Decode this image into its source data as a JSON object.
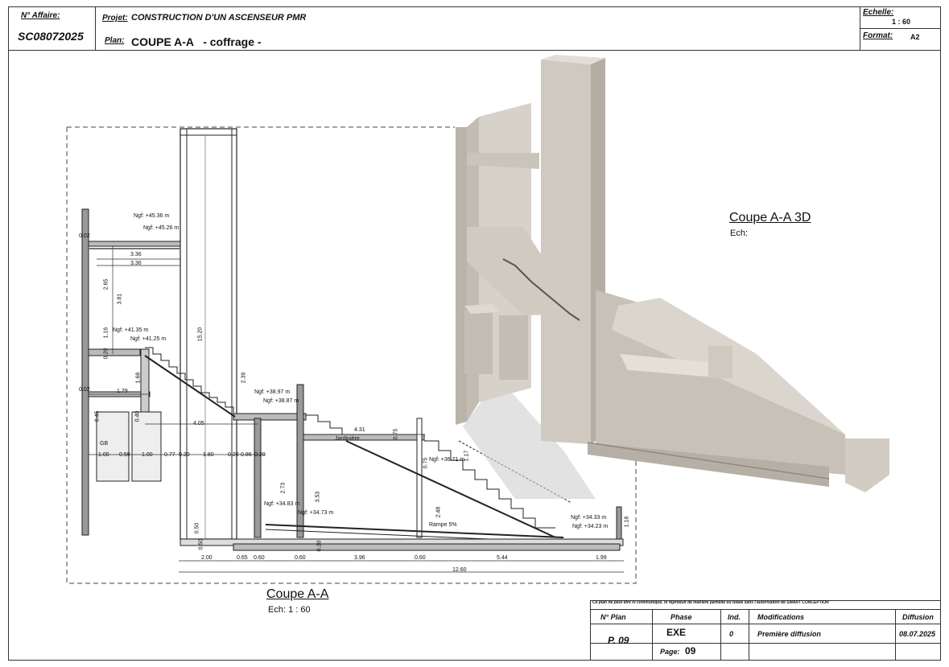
{
  "header": {
    "affaire_label": "N° Affaire:",
    "affaire_value": "SC08072025",
    "projet_label": "Projet:",
    "projet_value": "CONSTRUCTION D'UN ASCENSEUR PMR",
    "plan_label": "Plan:",
    "plan_value": "COUPE A-A   - coffrage -",
    "echelle_label": "Echelle:",
    "echelle_value": "1 : 60",
    "format_label": "Format:",
    "format_value": "A2"
  },
  "section_2d": {
    "title": "Coupe A-A",
    "scale": "Ech: 1 : 60",
    "levels": [
      "Ngf: +45.36 m",
      "Ngf: +45.26 m",
      "Ngf: +41.35 m",
      "Ngf: +41.25 m",
      "Ngf: +38.97 m",
      "Ngf: +38.87 m",
      "Ngf: +36.71 m",
      "Ngf: +34.83 m",
      "Ngf: +34.73 m",
      "Ngf: +34.33 m",
      "Ngf: +34.23 m"
    ],
    "labels": {
      "jardiniere": "Jardinière",
      "rampe": "Rampe 5%",
      "gb": "GB"
    },
    "dims": {
      "top_a": "3.36",
      "top_b": "3.36",
      "v_265": "2.65",
      "v_381": "3.81",
      "v_116": "1.16",
      "v_1520": "15.20",
      "v_020": "0.20",
      "v_168": "1.68",
      "v_239": "2.39",
      "h_179": "1.79",
      "h_405": "4.05",
      "h_431": "4.31",
      "v_075": "0.75",
      "v_117": "1.17",
      "v_273": "2.73",
      "v_353": "3.53",
      "v_248": "2.48",
      "v_118": "1.18",
      "v_050": "0.50",
      "v_030": "0.30",
      "v_002": "0.02",
      "v_045": "0.45",
      "v_040": "0.40",
      "row": [
        "1.00",
        "0.59",
        "1.00",
        "0.77",
        "0.20",
        "1.80",
        "0.20",
        "0.86",
        "0.20"
      ],
      "bottom": [
        "2.00",
        "0.65",
        "0.60",
        "0.60",
        "3.96",
        "0.60",
        "5.44",
        "1.99"
      ],
      "total": "12.60"
    }
  },
  "section_3d": {
    "title": "Coupe A-A 3D",
    "scale": "Ech:"
  },
  "cartouche": {
    "notice": "Ce plan ne peut être ni communiqué, ni reproduit de manière partielle ou totale sans l'autorisation de SMART CONCEPTION",
    "headers": [
      "N° Plan",
      "Phase",
      "Ind.",
      "Modifications",
      "Diffusion"
    ],
    "plan_no": "P. 09",
    "phase": "EXE",
    "page_label": "Page:",
    "page_no": "09",
    "ind": "0",
    "modification": "Première diffusion",
    "diffusion": "08.07.2025"
  }
}
